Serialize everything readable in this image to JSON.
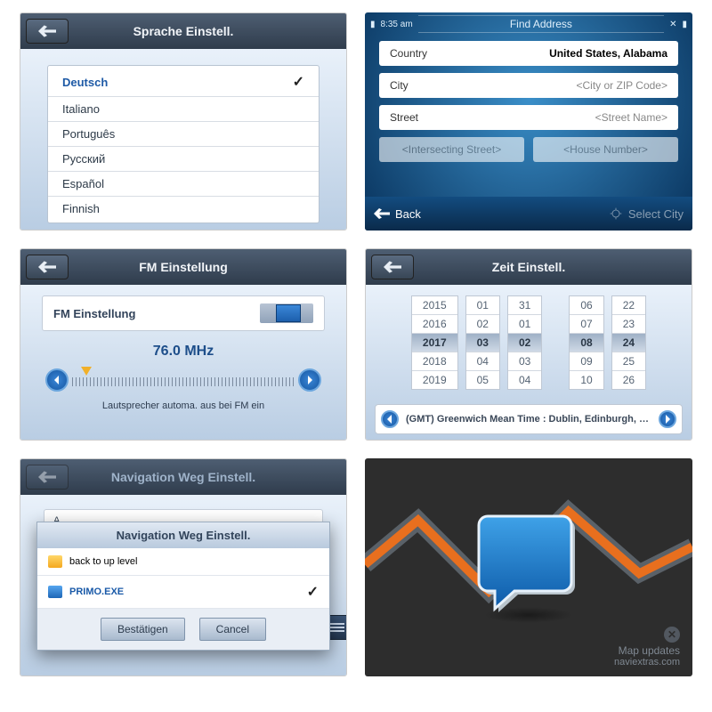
{
  "panel1": {
    "title": "Sprache Einstell.",
    "items": [
      "Deutsch",
      "Italiano",
      "Português",
      "Русский",
      "Español",
      "Finnish"
    ],
    "selected_index": 0
  },
  "panel2": {
    "time": "8:35 am",
    "title": "Find Address",
    "country_label": "Country",
    "country_value": "United States, Alabama",
    "city_label": "City",
    "city_placeholder": "<City or ZIP Code>",
    "street_label": "Street",
    "street_placeholder": "<Street Name>",
    "intersect_placeholder": "<Intersecting Street>",
    "house_placeholder": "<House Number>",
    "back_label": "Back",
    "select_label": "Select City"
  },
  "panel3": {
    "title": "FM Einstellung",
    "toggle_label": "FM Einstellung",
    "freq": "76.0 MHz",
    "note": "Lautsprecher automa. aus bei FM ein"
  },
  "panel4": {
    "title": "Zeit Einstell.",
    "years": [
      "2015",
      "2016",
      "2017",
      "2018",
      "2019"
    ],
    "months": [
      "01",
      "02",
      "03",
      "04",
      "05"
    ],
    "days_a": [
      "31",
      "01",
      "02",
      "03",
      "04"
    ],
    "hours": [
      "06",
      "07",
      "08",
      "09",
      "10"
    ],
    "mins": [
      "22",
      "23",
      "24",
      "25",
      "26"
    ],
    "selected_row": 2,
    "tz": "(GMT) Greenwich Mean Time : Dublin, Edinburgh, Lisb..."
  },
  "panel5": {
    "title": "Navigation Weg Einstell.",
    "back_up": "back to up level",
    "file": "PRIMO.EXE",
    "confirm": "Bestätigen",
    "cancel": "Cancel",
    "bg_label": "Navig",
    "bg_a": "A"
  },
  "panel6": {
    "line1": "Map updates",
    "line2": "naviextras.com"
  }
}
